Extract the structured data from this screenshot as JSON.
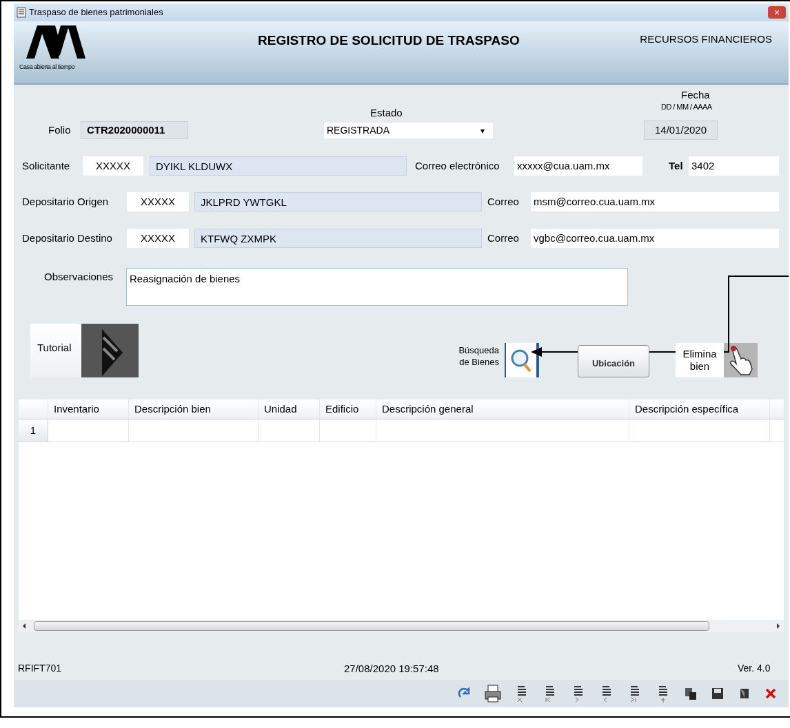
{
  "window": {
    "title": "Traspaso de bienes patrimoniales",
    "close": "×"
  },
  "header": {
    "logo_caption": "Casa abierta al tiempo",
    "title": "REGISTRO DE SOLICITUD DE TRASPASO",
    "department": "RECURSOS FINANCIEROS"
  },
  "folio": {
    "label": "Folio",
    "value": "CTR2020000011"
  },
  "estado": {
    "label": "Estado",
    "value": "REGISTRADA",
    "caret": "▾"
  },
  "fecha": {
    "label": "Fecha",
    "format": "DD / MM / AAAA",
    "value": "14/01/2020"
  },
  "people": [
    {
      "label": "Solicitante",
      "code": "XXXXX",
      "name": "DYIKL  KLDUWX",
      "email_label": "Correo electrónico",
      "email": "xxxxx@cua.uam.mx",
      "tel_label": "Tel",
      "tel": "3402"
    },
    {
      "label": "Depositario Origen",
      "code": "XXXXX",
      "name": "JKLPRD YWTGKL",
      "email_label": "Correo",
      "email": "msm@correo.cua.uam.mx"
    },
    {
      "label": "Depositario Destino",
      "code": "XXXXX",
      "name": "KTFWQ  ZXMPK",
      "email_label": "Correo",
      "email": "vgbc@correo.cua.uam.mx"
    }
  ],
  "observaciones": {
    "label": "Observaciones",
    "value": "Reasignación de bienes"
  },
  "actions": {
    "tutorial": "Tutorial",
    "search": "Búsqueda de Bienes",
    "location": "Ubicación",
    "delete": "Elimina bien"
  },
  "table": {
    "columns": [
      "Inventario",
      "Descripción bien",
      "Unidad",
      "Edificio",
      "Descripción general",
      "Descripción específica"
    ],
    "rows": [
      {
        "number": "1"
      }
    ]
  },
  "footer": {
    "code": "RFIFT701",
    "datetime": "27/08/2020 19:57:48",
    "version": "Ver. 4.0"
  }
}
